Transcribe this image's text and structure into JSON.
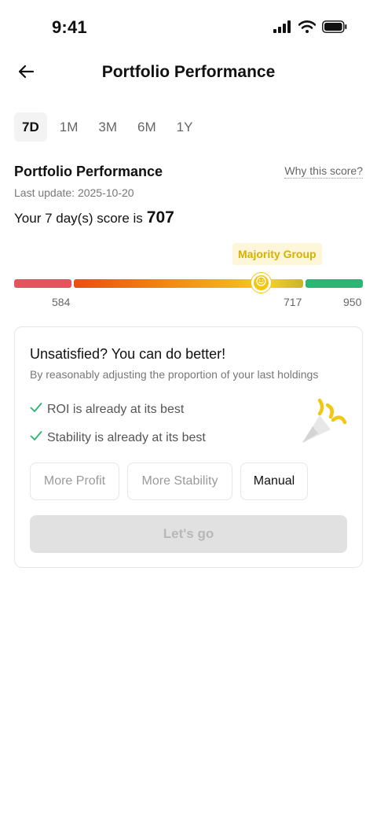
{
  "status_bar": {
    "time": "9:41",
    "icons": [
      "signal-icon",
      "wifi-icon",
      "battery-icon"
    ]
  },
  "nav": {
    "title": "Portfolio Performance",
    "back_icon": "arrow-left-icon"
  },
  "tabs": [
    {
      "label": "7D",
      "active": true
    },
    {
      "label": "1M",
      "active": false
    },
    {
      "label": "3M",
      "active": false
    },
    {
      "label": "6M",
      "active": false
    },
    {
      "label": "1Y",
      "active": false
    }
  ],
  "summary": {
    "title": "Portfolio Performance",
    "why_link": "Why this score?",
    "last_update": "Last update: 2025-10-20",
    "score_prefix": "Your 7 day(s) score is",
    "score_value": "707"
  },
  "score_bar": {
    "group_label": "Majority Group",
    "ticks": [
      "584",
      "717",
      "950"
    ],
    "score": 707,
    "colors": {
      "low": "#e5535e",
      "high": "#2bb673",
      "marker": "#f2c713"
    }
  },
  "card": {
    "title": "Unsatisfied? You can do better!",
    "subtitle": "By reasonably adjusting the proportion of your last holdings",
    "checks": [
      "ROI is already at its best",
      "Stability is already at its best"
    ],
    "options": [
      "More Profit",
      "More Stability",
      "Manual"
    ],
    "go_label": "Let's go"
  },
  "colors": {
    "accent_check": "#2bb673",
    "tag_bg": "#fdf6d9",
    "tag_text": "#d7b100"
  }
}
